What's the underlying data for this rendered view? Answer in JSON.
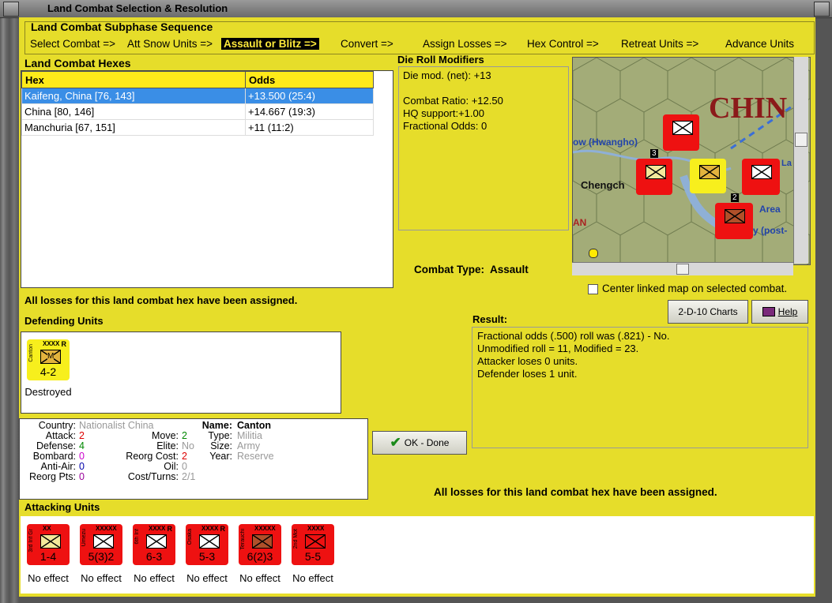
{
  "window": {
    "title": "Land Combat Selection & Resolution"
  },
  "subphase": {
    "title": "Land Combat Subphase Sequence",
    "steps": [
      "Select Combat =>",
      "Att Snow Units =>",
      "Assault or Blitz =>",
      "Convert =>",
      "Assign Losses =>",
      "Hex Control =>",
      "Retreat Units =>",
      "Advance Units"
    ]
  },
  "hexes": {
    "title": "Land Combat Hexes",
    "headers": [
      "Hex",
      "Odds"
    ],
    "rows": [
      {
        "hex": "Kaifeng, China [76, 143]",
        "odds": "+13.500 (25:4)"
      },
      {
        "hex": "China [80, 146]",
        "odds": "+14.667 (19:3)"
      },
      {
        "hex": "Manchuria [67, 151]",
        "odds": "+11 (11:2)"
      }
    ]
  },
  "die_roll": {
    "title": "Die Roll Modifiers",
    "net": "Die mod. (net): +13",
    "ratio": "Combat Ratio: +12.50",
    "hq": "HQ support:+1.00",
    "frac": "Fractional Odds: 0"
  },
  "map": {
    "label_china": "CHIN",
    "label_river": "ow (Hwangho)",
    "label_city": "Chengch",
    "label_area": "Area",
    "label_la": "La",
    "label_post": "y (post-",
    "label_an": "AN",
    "stack_3": "3",
    "stack_2": "2"
  },
  "combat_type": {
    "label": "Combat Type:",
    "value": "Assault"
  },
  "center_map": {
    "label": "Center linked map on selected combat."
  },
  "status_msg": "All losses for this land combat hex have been assigned.",
  "buttons": {
    "charts": "2-D-10 Charts",
    "help": "Help",
    "ok": "OK - Done"
  },
  "result": {
    "title": "Result:",
    "lines": [
      "Fractional odds (.500) roll was (.821)  - No.",
      "Unmodified roll = 11, Modified = 23.",
      "Attacker loses 0 units.",
      "Defender loses 1 unit."
    ]
  },
  "defending": {
    "title": "Defending Units",
    "units": [
      {
        "name": "Canton",
        "size": "XXXX",
        "rank": "R",
        "type": "M",
        "strength": "4-2",
        "status": "Destroyed"
      }
    ]
  },
  "details": {
    "country_label": "Country:",
    "country": "Nationalist China",
    "attack_label": "Attack:",
    "attack": "2",
    "defense_label": "Defense:",
    "defense": "4",
    "bombard_label": "Bombard:",
    "bombard": "0",
    "antiair_label": "Anti-Air:",
    "antiair": "0",
    "reorgpts_label": "Reorg Pts:",
    "reorgpts": "0",
    "move_label": "Move:",
    "move": "2",
    "elite_label": "Elite:",
    "elite": "No",
    "reorgcost_label": "Reorg Cost:",
    "reorgcost": "2",
    "oil_label": "Oil:",
    "oil": "0",
    "costturns_label": "Cost/Turns:",
    "costturns": "2/1",
    "name_label": "Name:",
    "name": "Canton",
    "type_label": "Type:",
    "type": "Militia",
    "size_label": "Size:",
    "size": "Army",
    "year_label": "Year:",
    "year": "Reserve"
  },
  "attacking": {
    "title": "Attacking Units",
    "units": [
      {
        "name": "3rd Inf Gr",
        "size": "XX",
        "rank": "",
        "strength": "1-4",
        "status": "No effect",
        "color": "#f4e89a"
      },
      {
        "name": "Umezu",
        "size": "XXXXX",
        "rank": "",
        "strength": "5(3)2",
        "status": "No effect",
        "color": "#ffffff"
      },
      {
        "name": "6th Inf",
        "size": "XXXX",
        "rank": "R",
        "strength": "6-3",
        "status": "No effect",
        "color": "#ffffff"
      },
      {
        "name": "Osaka",
        "size": "XXXX",
        "rank": "R",
        "strength": "5-3",
        "status": "No effect",
        "color": "#ffffff"
      },
      {
        "name": "Terauchi",
        "size": "XXXXX",
        "rank": "",
        "strength": "6(2)3",
        "status": "No effect",
        "color": "#b0502a"
      },
      {
        "name": "2nd Mot",
        "size": "XXXX",
        "rank": "",
        "strength": "5-5",
        "status": "No effect",
        "color": "#ee1111"
      }
    ]
  },
  "colors": {
    "panel": "#e6dd2a",
    "highlight": "#3a8ee6",
    "unit_red": "#ee1111",
    "unit_yellow": "#f7ef1d"
  }
}
